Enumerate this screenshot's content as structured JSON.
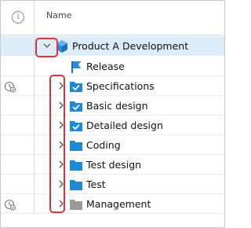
{
  "header": {
    "info_icon_glyph": "i",
    "name_column": "Name"
  },
  "rows": [
    {
      "label": "Product A Development",
      "icon": "product-cube-icon",
      "expanded": true,
      "selected": true,
      "status": false
    },
    {
      "label": "Release",
      "icon": "milestone-flag-icon",
      "expanded": null,
      "selected": false,
      "status": false
    },
    {
      "label": "Specifications",
      "icon": "folder-checked-icon",
      "expanded": false,
      "selected": false,
      "status": true
    },
    {
      "label": "Basic design",
      "icon": "folder-checked-icon",
      "expanded": false,
      "selected": false,
      "status": false
    },
    {
      "label": "Detailed design",
      "icon": "folder-checked-icon",
      "expanded": false,
      "selected": false,
      "status": false
    },
    {
      "label": "Coding",
      "icon": "folder-icon",
      "expanded": false,
      "selected": false,
      "status": false
    },
    {
      "label": "Test design",
      "icon": "folder-icon",
      "expanded": false,
      "selected": false,
      "status": false
    },
    {
      "label": "Test",
      "icon": "folder-icon",
      "expanded": false,
      "selected": false,
      "status": false
    },
    {
      "label": "Management",
      "icon": "folder-gray-icon",
      "expanded": false,
      "selected": false,
      "status": true
    }
  ],
  "colors": {
    "folder_blue": "#1e8ad6",
    "folder_gray": "#9a9a9a",
    "cube_blue": "#2a8fd8",
    "selection": "#dcecf8",
    "highlight_red": "#e0303a"
  }
}
